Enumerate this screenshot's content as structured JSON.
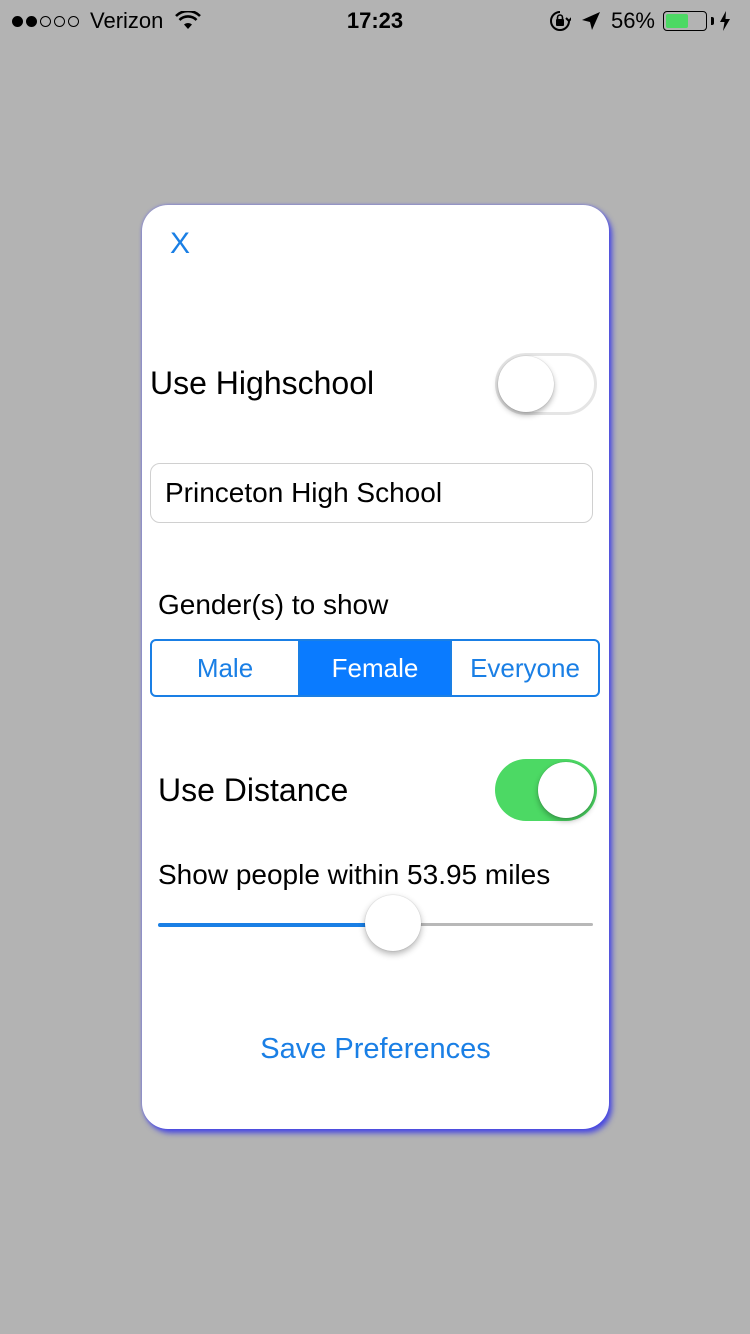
{
  "status_bar": {
    "signal_bars_filled": 2,
    "signal_bars_total": 5,
    "carrier": "Verizon",
    "time": "17:23",
    "battery_percent_label": "56%",
    "battery_level": 0.56,
    "battery_color": "#4cd964",
    "icons": [
      "wifi-icon",
      "rotation-lock-icon",
      "location-arrow-icon",
      "battery-icon",
      "charging-bolt-icon"
    ]
  },
  "modal": {
    "close_label": "X",
    "highschool": {
      "label": "Use Highschool",
      "toggle_on": false,
      "school_value": "Princeton High School"
    },
    "gender": {
      "label": "Gender(s) to show",
      "options": [
        "Male",
        "Female",
        "Everyone"
      ],
      "selected": "Female"
    },
    "distance": {
      "label": "Use Distance",
      "toggle_on": true,
      "within_label": "Show people within 53.95 miles",
      "slider_fraction": 0.54
    },
    "save_label": "Save Preferences"
  },
  "colors": {
    "accent": "#1a7fe5",
    "selected_segment": "#0a7bff",
    "toggle_on": "#4cd964",
    "background": "#b3b3b3",
    "modal_shadow": "#3c3ce6"
  }
}
